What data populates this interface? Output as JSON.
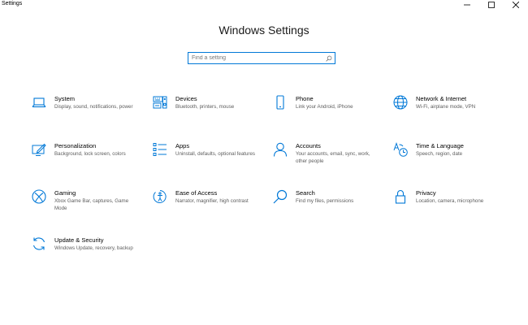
{
  "window": {
    "title": "Settings",
    "controls": {
      "minimize": "minimize-icon",
      "maximize": "maximize-icon",
      "close": "close-icon"
    }
  },
  "header": {
    "title": "Windows Settings",
    "search": {
      "placeholder": "Find a setting",
      "value": ""
    }
  },
  "accent": "#0078d7",
  "categories": [
    {
      "name": "System",
      "desc": "Display, sound, notifications, power",
      "icon": "laptop-icon"
    },
    {
      "name": "Devices",
      "desc": "Bluetooth, printers, mouse",
      "icon": "keyboard-speaker-icon"
    },
    {
      "name": "Phone",
      "desc": "Link your Android, iPhone",
      "icon": "phone-icon"
    },
    {
      "name": "Network & Internet",
      "desc": "Wi-Fi, airplane mode, VPN",
      "icon": "globe-icon"
    },
    {
      "name": "Personalization",
      "desc": "Background, lock screen, colors",
      "icon": "pen-monitor-icon"
    },
    {
      "name": "Apps",
      "desc": "Uninstall, defaults, optional features",
      "icon": "apps-list-icon"
    },
    {
      "name": "Accounts",
      "desc": "Your accounts, email, sync, work, other people",
      "icon": "person-icon"
    },
    {
      "name": "Time & Language",
      "desc": "Speech, region, date",
      "icon": "time-language-icon"
    },
    {
      "name": "Gaming",
      "desc": "Xbox Game Bar, captures, Game Mode",
      "icon": "xbox-icon"
    },
    {
      "name": "Ease of Access",
      "desc": "Narrator, magnifier, high contrast",
      "icon": "ease-of-access-icon"
    },
    {
      "name": "Search",
      "desc": "Find my files, permissions",
      "icon": "magnifier-icon"
    },
    {
      "name": "Privacy",
      "desc": "Location, camera, microphone",
      "icon": "lock-icon"
    },
    {
      "name": "Update & Security",
      "desc": "Windows Update, recovery, backup",
      "icon": "sync-arrows-icon"
    }
  ]
}
